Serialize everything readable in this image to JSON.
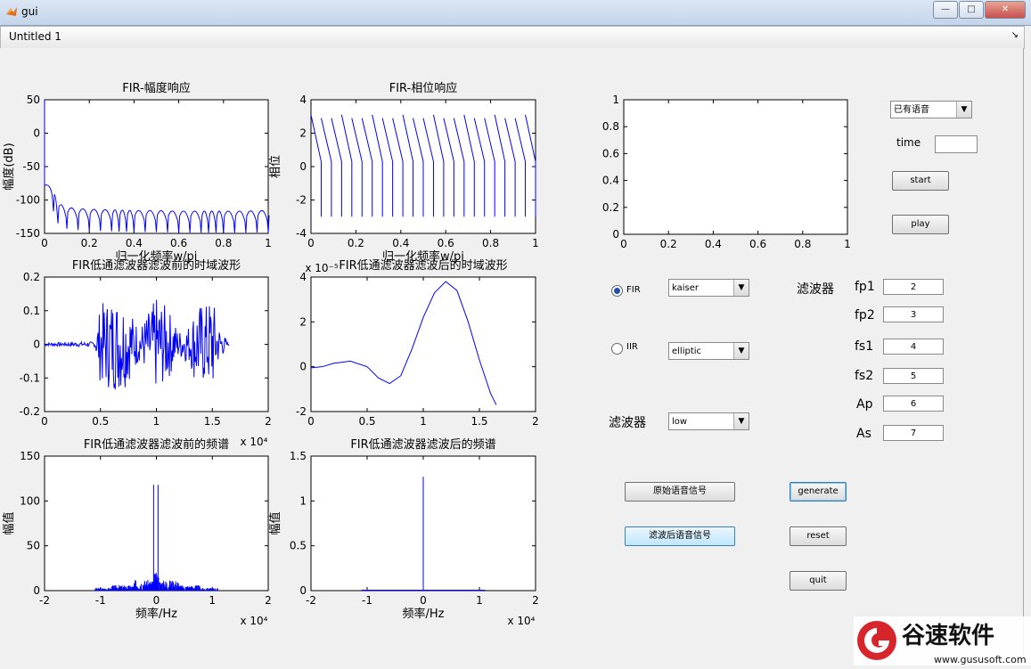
{
  "window": {
    "title": "gui"
  },
  "menubar": {
    "figure_title": "Untitled 1",
    "arrow": "↘"
  },
  "chart_data": [
    {
      "type": "line",
      "title": "FIR-幅度响应",
      "xlabel": "归一化频率w/pi",
      "ylabel": "幅度(dB)",
      "xlim": [
        0,
        1
      ],
      "ylim": [
        -150,
        50
      ],
      "xticks": [
        "0",
        "0.2",
        "0.4",
        "0.6",
        "0.8",
        "1"
      ],
      "yticks": [
        "50",
        "0",
        "-50",
        "-100",
        "-150"
      ],
      "series": [
        {
          "x": [
            0,
            0.02,
            0.04,
            0.06,
            0.1,
            0.15,
            0.2,
            0.3,
            0.4,
            0.5,
            0.6,
            0.7,
            0.8,
            0.9,
            1.0
          ],
          "y": [
            50,
            -78,
            -82,
            -100,
            -108,
            -110,
            -111,
            -112,
            -113,
            -113,
            -114,
            -114,
            -114,
            -114,
            -113
          ]
        }
      ]
    },
    {
      "type": "line",
      "title": "FIR-相位响应",
      "xlabel": "归一化频率w/pi",
      "ylabel": "相位",
      "xlim": [
        0,
        1
      ],
      "ylim": [
        -4,
        4
      ],
      "xticks": [
        "0",
        "0.2",
        "0.4",
        "0.6",
        "0.8",
        "1"
      ],
      "yticks": [
        "4",
        "2",
        "0",
        "-2",
        "-4"
      ],
      "series": [
        {
          "x": [
            0,
            1
          ],
          "y": [
            3.1,
            -3.1
          ],
          "wraps": 22
        }
      ]
    },
    {
      "type": "line",
      "title": "",
      "xlim": [
        0,
        1
      ],
      "ylim": [
        0,
        1
      ],
      "xticks": [
        "0",
        "0.2",
        "0.4",
        "0.6",
        "0.8",
        "1"
      ],
      "yticks": [
        "1",
        "0.8",
        "0.6",
        "0.4",
        "0.2",
        "0"
      ],
      "series": []
    },
    {
      "type": "line",
      "title": "FIR低通滤波器滤波前的时域波形",
      "xlim": [
        0,
        20000
      ],
      "ylim": [
        -0.2,
        0.2
      ],
      "xticks": [
        "0",
        "0.5",
        "1",
        "1.5",
        "2"
      ],
      "yticks": [
        "0.2",
        "0.1",
        "0",
        "-0.1",
        "-0.2"
      ],
      "x_exponent": "x 10⁴",
      "series": [
        {
          "x": [
            0,
            4500,
            5000,
            6000,
            7000,
            8500,
            9500,
            10000,
            11000,
            12000,
            13000,
            13500,
            14500,
            15000,
            15500,
            16500
          ],
          "envelope": [
            0.005,
            0.008,
            0.12,
            0.14,
            0.14,
            0.05,
            0.11,
            0.14,
            0.11,
            0.04,
            0.06,
            0.12,
            0.12,
            0.15,
            0.06,
            0.0
          ]
        }
      ]
    },
    {
      "type": "line",
      "title": "FIR低通滤波器滤波后的时域波形",
      "xlim": [
        0,
        2
      ],
      "ylim": [
        -2,
        4
      ],
      "xticks": [
        "0",
        "0.5",
        "1",
        "1.5",
        "2"
      ],
      "yticks": [
        "4",
        "2",
        "0",
        "-2"
      ],
      "y_exponent": "x 10⁻⁵",
      "series": [
        {
          "x": [
            0,
            0.1,
            0.2,
            0.35,
            0.5,
            0.6,
            0.7,
            0.8,
            0.9,
            1.0,
            1.1,
            1.2,
            1.3,
            1.4,
            1.5,
            1.6,
            1.65
          ],
          "y": [
            -0.05,
            0.0,
            0.15,
            0.25,
            0.0,
            -0.5,
            -0.75,
            -0.4,
            0.8,
            2.2,
            3.3,
            3.8,
            3.4,
            2.0,
            0.3,
            -1.2,
            -1.7
          ]
        }
      ]
    },
    {
      "type": "line",
      "title": "FIR低通滤波器滤波前的频谱",
      "xlabel": "频率/Hz",
      "ylabel": "幅值",
      "xlim": [
        -2,
        2
      ],
      "ylim": [
        0,
        150
      ],
      "xticks": [
        "-2",
        "-1",
        "0",
        "1",
        "2"
      ],
      "yticks": [
        "150",
        "100",
        "50",
        "0"
      ],
      "x_exponent": "x 10⁴",
      "series": [
        {
          "x": [
            -1.1,
            -0.9,
            -0.6,
            -0.3,
            -0.1,
            -0.05,
            0,
            0.05,
            0.1,
            0.3,
            0.6,
            0.9,
            1.1
          ],
          "y": [
            2,
            4,
            5,
            8,
            20,
            118,
            10,
            118,
            20,
            8,
            5,
            4,
            2
          ]
        }
      ]
    },
    {
      "type": "line",
      "title": "FIR低通滤波器滤波后的频谱",
      "xlabel": "频率/Hz",
      "ylabel": "幅值",
      "xlim": [
        -2,
        2
      ],
      "ylim": [
        0,
        1.5
      ],
      "xticks": [
        "-2",
        "-1",
        "0",
        "1",
        "2"
      ],
      "yticks": [
        "1.5",
        "1",
        "0.5",
        "0"
      ],
      "x_exponent": "x 10⁴",
      "series": [
        {
          "x": [
            -1.1,
            0,
            1.1
          ],
          "y": [
            0.005,
            1.27,
            0.005
          ]
        }
      ]
    }
  ],
  "controls": {
    "source_select": "已有语音",
    "time_label": "time",
    "time_value": "",
    "start_label": "start",
    "play_label": "play",
    "fir_radio": "FIR",
    "iir_radio": "IIR",
    "window_select": "kaiser",
    "iir_select": "elliptic",
    "filter_type_label": "滤波器",
    "filter_type_select": "low",
    "filter_label": "滤波器",
    "params": [
      {
        "name": "fp1",
        "value": "2"
      },
      {
        "name": "fp2",
        "value": "3"
      },
      {
        "name": "fs1",
        "value": "4"
      },
      {
        "name": "fs2",
        "value": "5"
      },
      {
        "name": "Ap",
        "value": "6"
      },
      {
        "name": "As",
        "value": "7"
      }
    ],
    "orig_button": "原始语音信号",
    "filtered_button": "滤波后语音信号",
    "generate_button": "generate",
    "reset_button": "reset",
    "quit_button": "quit"
  },
  "watermark": {
    "brand": "谷速软件",
    "url": "www.gususoft.com"
  },
  "colors": {
    "plot_line": "#0000ff",
    "plot_bg": "#ffffff",
    "figure_bg": "#f0f0f0"
  }
}
